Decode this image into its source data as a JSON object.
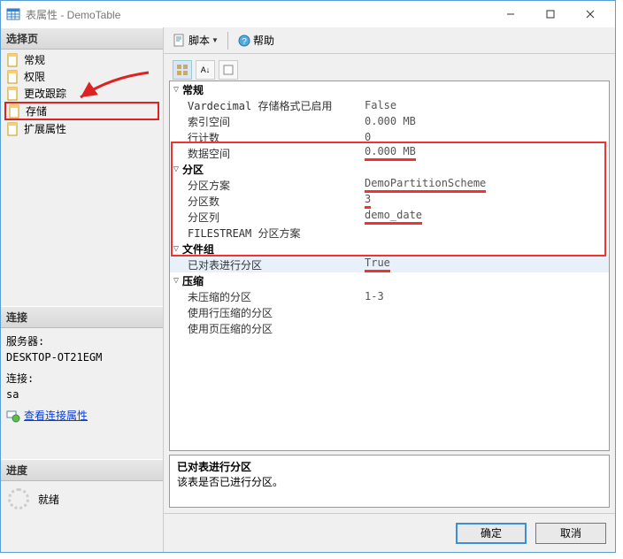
{
  "title": "表属性 - DemoTable",
  "left": {
    "select_page": "选择页",
    "nav": [
      "常规",
      "权限",
      "更改跟踪",
      "存储",
      "扩展属性"
    ],
    "selected": 3,
    "conn_hd": "连接",
    "server_lbl": "服务器:",
    "server_val": "DESKTOP-OT21EGM",
    "conn_lbl": "连接:",
    "conn_val": "sa",
    "view_conn": "查看连接属性",
    "prog_hd": "进度",
    "status": "就绪"
  },
  "toolbar": {
    "script": "脚本",
    "help": "帮助"
  },
  "grid": {
    "cat_general": "常规",
    "g1": {
      "k": "Vardecimal 存储格式已启用",
      "v": "False"
    },
    "g2": {
      "k": "索引空间",
      "v": "0.000 MB"
    },
    "g3": {
      "k": "行计数",
      "v": "0"
    },
    "g4": {
      "k": "数据空间",
      "v": "0.000 MB"
    },
    "cat_partition": "分区",
    "p1": {
      "k": "分区方案",
      "v": "DemoPartitionScheme"
    },
    "p2": {
      "k": "分区数",
      "v": "3"
    },
    "p3": {
      "k": "分区列",
      "v": "demo_date"
    },
    "p4": {
      "k": "FILESTREAM 分区方案",
      "v": ""
    },
    "cat_filegroup": "文件组",
    "f1": {
      "k": "已对表进行分区",
      "v": "True"
    },
    "cat_compress": "压缩",
    "c1": {
      "k": "未压缩的分区",
      "v": "1-3"
    },
    "c2": {
      "k": "使用行压缩的分区",
      "v": ""
    },
    "c3": {
      "k": "使用页压缩的分区",
      "v": ""
    }
  },
  "desc": {
    "title": "已对表进行分区",
    "body": "该表是否已进行分区。"
  },
  "buttons": {
    "ok": "确定",
    "cancel": "取消"
  }
}
